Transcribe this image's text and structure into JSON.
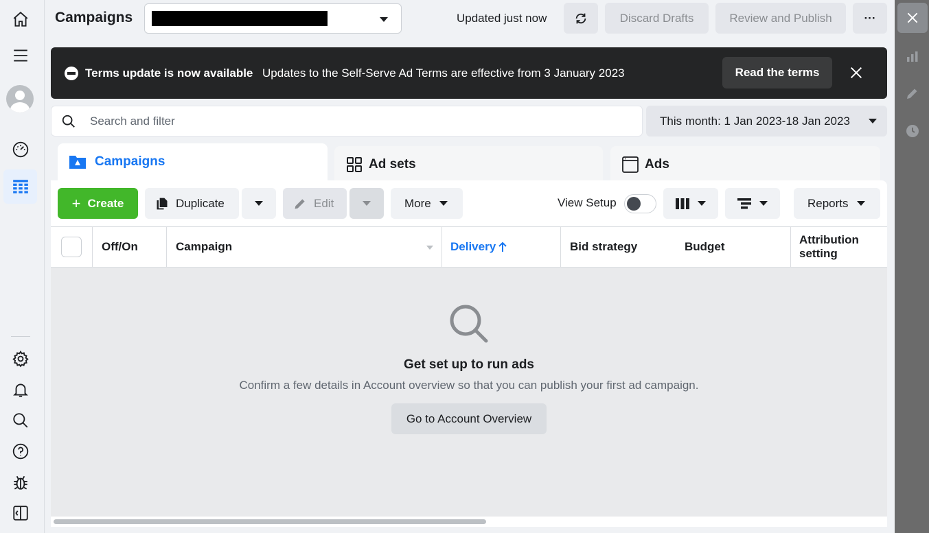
{
  "header": {
    "title": "Campaigns",
    "updated_text": "Updated just now",
    "discard_label": "Discard Drafts",
    "publish_label": "Review and Publish"
  },
  "banner": {
    "title": "Terms update is now available",
    "text": "Updates to the Self-Serve Ad Terms are effective from 3 January 2023",
    "button_label": "Read the terms"
  },
  "search": {
    "placeholder": "Search and filter",
    "value": ""
  },
  "date_range": "This month: 1 Jan 2023-18 Jan 2023",
  "tabs": [
    {
      "label": "Campaigns",
      "icon": "folder-icon",
      "active": true
    },
    {
      "label": "Ad sets",
      "icon": "grid-icon",
      "active": false
    },
    {
      "label": "Ads",
      "icon": "ad-window-icon",
      "active": false
    }
  ],
  "toolbar": {
    "create_label": "Create",
    "duplicate_label": "Duplicate",
    "edit_label": "Edit",
    "more_label": "More",
    "view_setup_label": "View Setup",
    "reports_label": "Reports"
  },
  "table": {
    "columns": [
      "Off/On",
      "Campaign",
      "Delivery",
      "Bid strategy",
      "Budget",
      "Attribution setting"
    ],
    "sorted_column": "Delivery"
  },
  "empty_state": {
    "title": "Get set up to run ads",
    "description": "Confirm a few details in Account overview so that you can publish your first ad campaign.",
    "button_label": "Go to Account Overview"
  },
  "colors": {
    "accent": "#1877f2",
    "create": "#42b72a",
    "banner_bg": "#242526"
  }
}
